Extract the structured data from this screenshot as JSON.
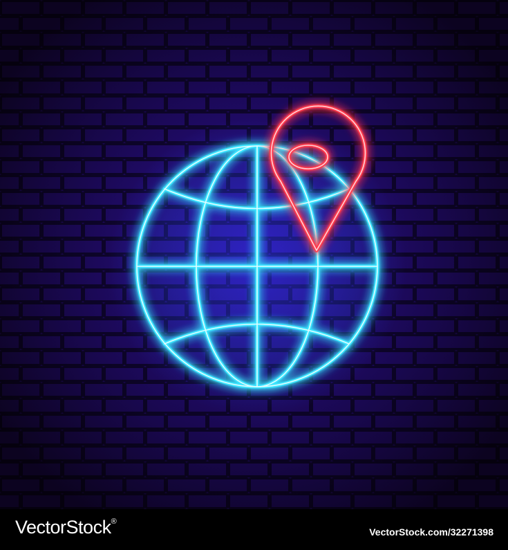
{
  "image": {
    "subject": "neon globe with location pin on brick wall",
    "icons": [
      "globe-icon",
      "location-pin-icon"
    ],
    "colors": {
      "wall_background": "#14062e",
      "wall_glow": "#2a1080",
      "globe_neon": "#2fe0ff",
      "pin_neon": "#ff3a4e",
      "footer_background": "#000000",
      "footer_text": "#ffffff"
    }
  },
  "watermark": {
    "logo_text": "VectorStock",
    "registered_mark": "®",
    "image_id": "VectorStock.com/32271398"
  }
}
